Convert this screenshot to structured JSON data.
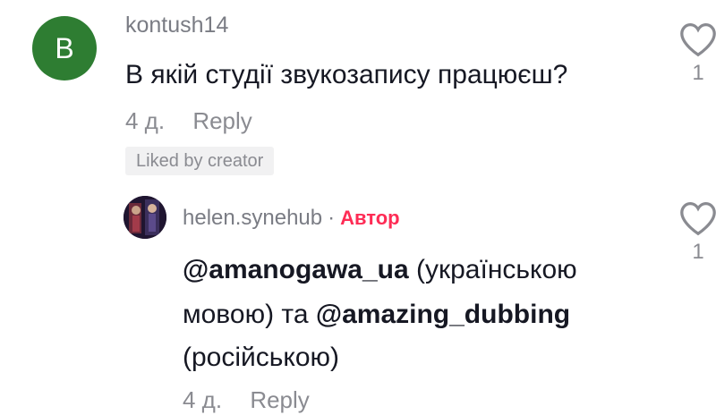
{
  "colors": {
    "avatar_bg": "#2e7d32",
    "author_badge": "#fe2c55",
    "muted": "#8a8b91",
    "text": "#161823"
  },
  "comment": {
    "avatar_letter": "B",
    "username": "kontush14",
    "text": "В якій студії звукозапису працюєш?",
    "time": "4 д.",
    "reply_label": "Reply",
    "liked_badge": "Liked by creator",
    "like_count": "1",
    "like_icon": "heart-outline-icon"
  },
  "reply": {
    "username": "helen.synehub",
    "separator": "·",
    "author_badge": "Автор",
    "line1_mention": "@amanogawa_ua",
    "line1_rest": " (українською",
    "line2_start": "мовою) та ",
    "line2_mention": "@amazing_dubbing",
    "line3": "(російською)",
    "time": "4 д.",
    "reply_label": "Reply",
    "like_count": "1",
    "like_icon": "heart-outline-icon"
  }
}
